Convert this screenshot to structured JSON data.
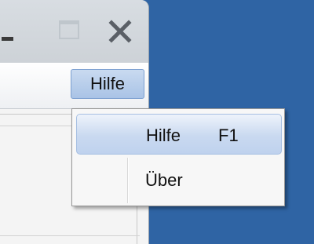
{
  "menubar": {
    "help_menu_label": "Hilfe"
  },
  "dropdown": {
    "items": [
      {
        "label": "Hilfe",
        "shortcut": "F1",
        "highlighted": true
      },
      {
        "label": "Über"
      }
    ]
  },
  "colors": {
    "desktop": "#2f64a4",
    "highlight": "#c9d9f0"
  },
  "icons": {
    "minimize": "minimize-icon",
    "maximize": "maximize-icon",
    "close": "close-icon"
  }
}
